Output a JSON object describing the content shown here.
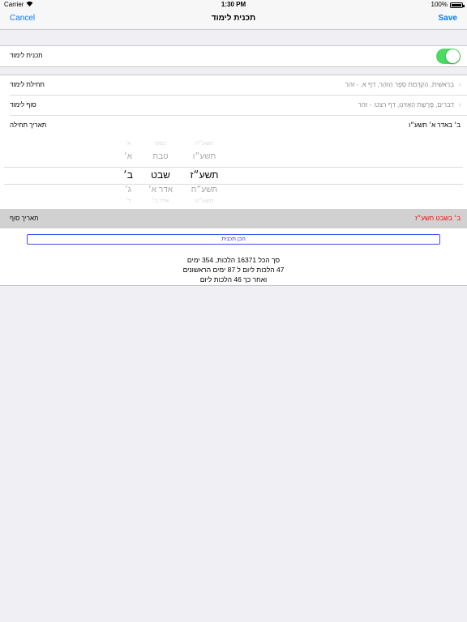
{
  "status": {
    "carrier": "Carrier",
    "time": "1:30 PM",
    "battery": "100%"
  },
  "nav": {
    "cancel": "Cancel",
    "title": "תכנית לימוד",
    "save": "Save"
  },
  "plan": {
    "label": "תכנית לימוד",
    "enabled": true
  },
  "start": {
    "label": "תחילת לימוד",
    "value": "בְּרֵאשִׁית, הַקְדָּמַת סֵפֶר הַזֹּהַר, דף א. - זהר"
  },
  "end": {
    "label": "סוף לימוד",
    "value": "דברים, פָּרָשַׁת הַאֲזִינוּ, דף רצט: - זהר"
  },
  "start_date": {
    "label": "תאריך תחילה",
    "value": "ב׳ באדר א׳ תשע״ו"
  },
  "picker": {
    "day": [
      "א׳",
      "א׳",
      "ב׳",
      "ג׳",
      "ד׳"
    ],
    "month": [
      "כסלו",
      "טבת",
      "שבט",
      "אדר א׳",
      "אדר ב׳"
    ],
    "year": [
      "תשע״ה",
      "תשע״ו",
      "תשע״ז",
      "תשע״ח",
      "תשע״ט"
    ]
  },
  "end_date": {
    "label": "תאריך סוף",
    "value": "ב׳ בשבט תשע״ז"
  },
  "prepare": {
    "label": "הכן תכנית"
  },
  "summary": {
    "line1": "סך הכל 16371 הלכות, 354 ימים",
    "line2": "47 הלכות ליום ל 87 ימים הראשונים",
    "line3": "ואחר כך 46 הלכות ליום"
  },
  "colors": {
    "accent": "#007aff",
    "toggle_on": "#4cd964",
    "end_date_value": "#ff0000",
    "prepare_border": "#3b4ef0"
  }
}
